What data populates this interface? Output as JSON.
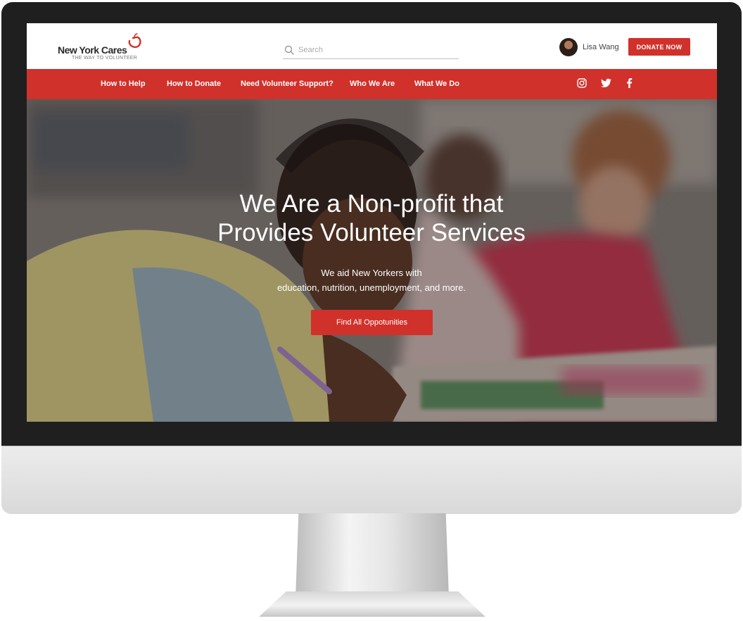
{
  "brand": {
    "name": "New York Cares",
    "tagline": "THE WAY TO VOLUNTEER",
    "accent_color": "#d1312b"
  },
  "search": {
    "placeholder": "Search",
    "icon": "search-icon"
  },
  "user": {
    "name": "Lisa Wang"
  },
  "header": {
    "donate_label": "DONATE NOW"
  },
  "nav": {
    "items": [
      {
        "label": "How to Help"
      },
      {
        "label": "How to Donate"
      },
      {
        "label": "Need Volunteer Support?"
      },
      {
        "label": "Who We Are"
      },
      {
        "label": "What We Do"
      }
    ],
    "social": [
      "instagram-icon",
      "twitter-icon",
      "facebook-icon"
    ]
  },
  "hero": {
    "title_line1": "We Are a Non-profit that",
    "title_line2": "Provides Volunteer Services",
    "subtitle_line1": "We aid New Yorkers with",
    "subtitle_line2": "education, nutrition, unemployment, and more.",
    "cta_label": "Find All Oppotunities"
  }
}
